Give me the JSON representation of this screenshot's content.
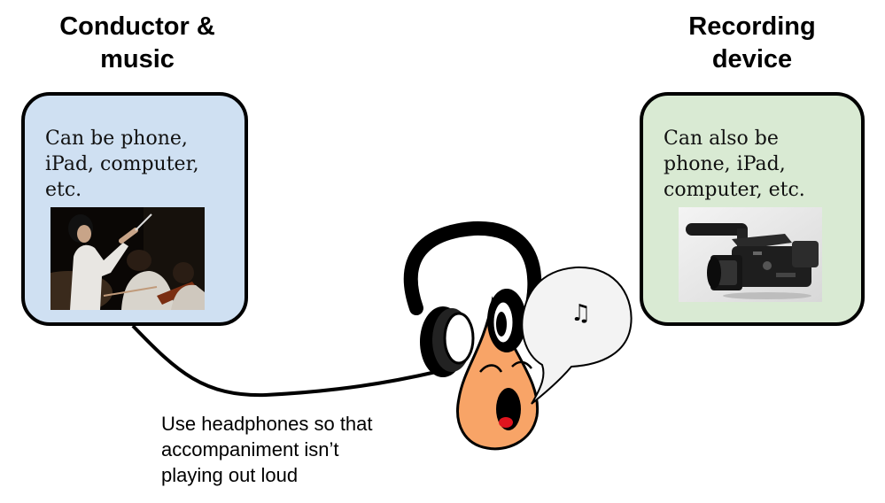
{
  "left_panel": {
    "heading_lines": [
      "Conductor &",
      "music"
    ],
    "body_lines": [
      "Can be phone,",
      "iPad, computer,",
      "etc."
    ],
    "photo": "conductor-photo",
    "color": "#cfe0f2"
  },
  "right_panel": {
    "heading_lines": [
      "Recording",
      "device"
    ],
    "body_lines": [
      "Can also be",
      "phone, iPad,",
      "computer, etc."
    ],
    "photo": "camcorder-photo",
    "color": "#d9ead3"
  },
  "caption_lines": [
    "Use headphones so that",
    "accompaniment isn’t",
    "playing out loud"
  ],
  "singer": {
    "icon": "singing-face-with-headphones",
    "speech_bubble_symbol": "♫",
    "face_color": "#f8a467"
  }
}
